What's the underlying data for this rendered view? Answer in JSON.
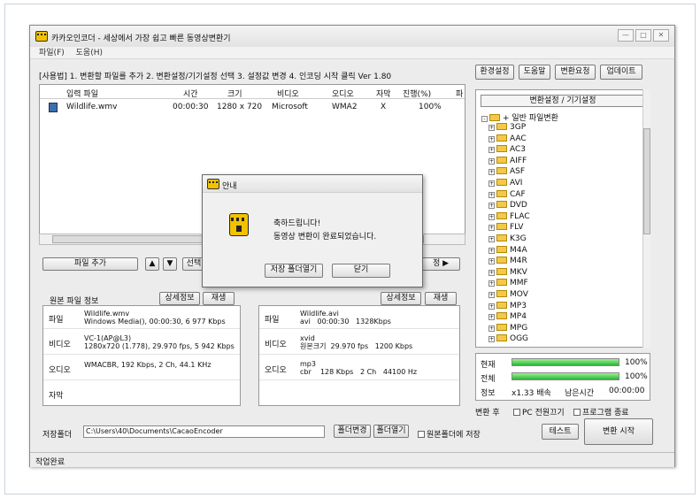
{
  "window": {
    "title": "카카오인코더 - 세상에서 가장 쉽고 빠른 동영상변환기",
    "buttons": [
      "—",
      "□",
      "✕"
    ]
  },
  "menu": [
    "파일(F)",
    "도움(H)"
  ],
  "hint": "[사용법] 1. 변환할 파일를 추가  2. 변환설정/기기설정 선택  3. 설정값 변경  4. 인코딩 시작 클릭  Ver 1.80",
  "top_buttons": [
    "환경설정",
    "도움말",
    "변환요청",
    "업데이트"
  ],
  "file_list": {
    "columns": [
      "입력 파일",
      "시간",
      "크기",
      "비디오",
      "오디오",
      "자막",
      "진행(%)",
      "파"
    ],
    "rows": [
      {
        "name": "Wildlife.wmv",
        "time": "00:00:30",
        "size": "1280 x 720",
        "video": "Microsoft",
        "audio": "WMA2",
        "subtitle": "X",
        "progress": "100%"
      }
    ]
  },
  "list_controls": {
    "add": "파일 추가",
    "up": "▲",
    "down": "▼",
    "select": "선택",
    "next": "정 ▶"
  },
  "source_info": {
    "title": "원본 파일 정보",
    "detail_button": "상세정보",
    "play_button": "재생",
    "rows": [
      {
        "label": "파일",
        "value": "Wildlife.wmv\nWindows Media(), 00:00:30, 6 977 Kbps"
      },
      {
        "label": "비디오",
        "value": "VC-1(AP@L3)\n1280x720 (1.778), 29.970 fps, 5 942 Kbps"
      },
      {
        "label": "오디오",
        "value": "WMACBR, 192 Kbps, 2 Ch, 44.1 KHz"
      },
      {
        "label": "자막",
        "value": ""
      }
    ]
  },
  "output_info": {
    "detail_button": "상세정보",
    "play_button": "재생",
    "rows": [
      {
        "label": "파일",
        "value": "Wildlife.avi\navi   00:00:30   1328Kbps"
      },
      {
        "label": "비디오",
        "value": "xvid\n원본크기  29.970 fps   1200 Kbps"
      },
      {
        "label": "오디오",
        "value": "mp3\ncbr    128 Kbps   2 Ch   44100 Hz"
      }
    ]
  },
  "tree": {
    "header": "변환설정 / 기기설정",
    "root": "+ 일반 파일변환",
    "items": [
      "3GP",
      "AAC",
      "AC3",
      "AIFF",
      "ASF",
      "AVI",
      "CAF",
      "DVD",
      "FLAC",
      "FLV",
      "K3G",
      "M4A",
      "M4R",
      "MKV",
      "MMF",
      "MOV",
      "MP3",
      "MP4",
      "MPG",
      "OGG"
    ]
  },
  "progress": {
    "current_label": "현재",
    "current_pct": "100%",
    "current_value": 1.0,
    "total_label": "전체",
    "total_pct": "100%",
    "total_value": 1.0,
    "info_label": "정보",
    "speed": "x1.33 배속",
    "remain_label": "남은시간",
    "remain": "00:00:00"
  },
  "after": {
    "label": "변환 후",
    "opt1": "PC 전원끄기",
    "opt2": "프로그램 종료"
  },
  "save": {
    "label": "저장폴더",
    "path": "C:\\Users\\40\\Documents\\CacaoEncoder",
    "change": "폴더변경",
    "open": "폴더열기",
    "original": "원본폴더에 저장"
  },
  "actions": {
    "test": "테스트",
    "start": "변환 시작"
  },
  "status": "작업완료",
  "dialog": {
    "title": "안내",
    "line1": "축하드립니다!",
    "line2": "동영상 변환이 완료되었습니다.",
    "open_folder": "저장 폴더열기",
    "close": "닫기"
  },
  "colors": {
    "progress": "#29b531",
    "folder": "#f2c94c",
    "accent": "#f2c200"
  }
}
